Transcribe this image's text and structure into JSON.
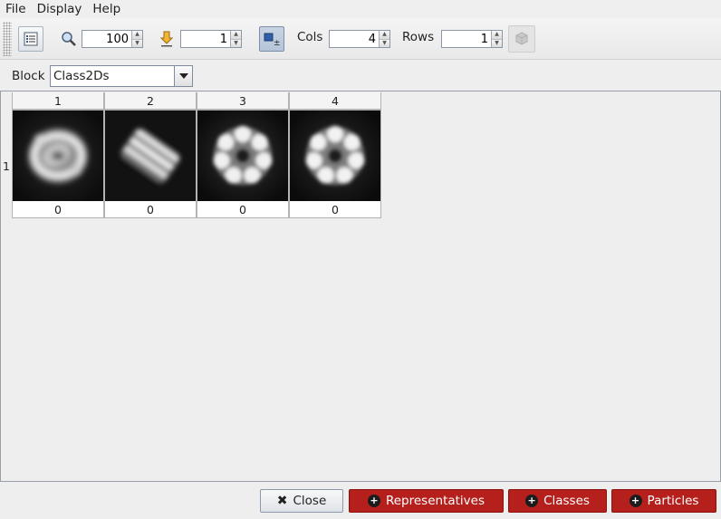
{
  "menu": {
    "items": [
      "File",
      "Display",
      "Help"
    ]
  },
  "toolbar": {
    "zoom_value": "100",
    "goto_value": "1",
    "cols_label": "Cols",
    "cols_value": "4",
    "rows_label": "Rows",
    "rows_value": "1"
  },
  "block": {
    "label": "Block",
    "selected": "Class2Ds"
  },
  "gallery": {
    "columns": [
      "1",
      "2",
      "3",
      "4"
    ],
    "rows": [
      "1"
    ],
    "cells": [
      {
        "label": "0",
        "image": "class-average-ring"
      },
      {
        "label": "0",
        "image": "class-average-sideview"
      },
      {
        "label": "0",
        "image": "class-average-heptamer"
      },
      {
        "label": "0",
        "image": "class-average-heptamer"
      }
    ]
  },
  "footer": {
    "close_label": "Close",
    "representatives_label": "Representatives",
    "classes_label": "Classes",
    "particles_label": "Particles"
  },
  "colors": {
    "accent_red": "#b5201d",
    "selected_toggle": "#b6c5da"
  }
}
